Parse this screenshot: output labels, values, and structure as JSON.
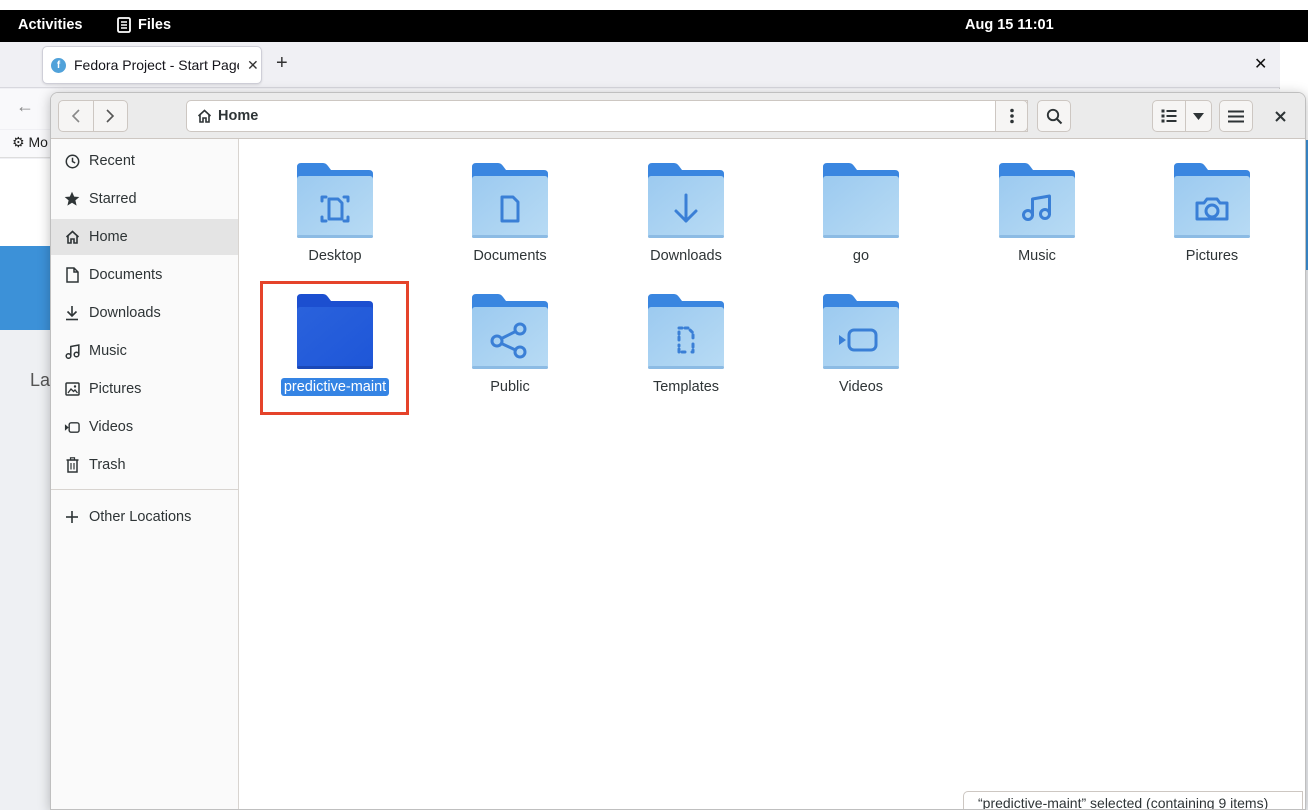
{
  "panel": {
    "activities": "Activities",
    "app_name": "Files",
    "clock": "Aug 15  11:01"
  },
  "browser": {
    "tab_title": "Fedora Project - Start Page",
    "bookmark_partial": "Mo",
    "content_partial": "La"
  },
  "files": {
    "path_label": "Home",
    "sidebar": [
      {
        "label": "Recent",
        "icon": "clock-icon"
      },
      {
        "label": "Starred",
        "icon": "star-icon"
      },
      {
        "label": "Home",
        "icon": "home-icon",
        "active": true
      },
      {
        "label": "Documents",
        "icon": "document-icon"
      },
      {
        "label": "Downloads",
        "icon": "download-icon"
      },
      {
        "label": "Music",
        "icon": "music-icon"
      },
      {
        "label": "Pictures",
        "icon": "picture-icon"
      },
      {
        "label": "Videos",
        "icon": "video-icon"
      },
      {
        "label": "Trash",
        "icon": "trash-icon"
      }
    ],
    "other_locations": "Other Locations",
    "folders": [
      {
        "label": "Desktop",
        "emblem": "desktop"
      },
      {
        "label": "Documents",
        "emblem": "document"
      },
      {
        "label": "Downloads",
        "emblem": "download"
      },
      {
        "label": "go",
        "emblem": "none"
      },
      {
        "label": "Music",
        "emblem": "music"
      },
      {
        "label": "Pictures",
        "emblem": "camera"
      },
      {
        "label": "predictive-maint",
        "emblem": "none",
        "selected": true
      },
      {
        "label": "Public",
        "emblem": "share"
      },
      {
        "label": "Templates",
        "emblem": "template"
      },
      {
        "label": "Videos",
        "emblem": "video"
      }
    ],
    "status": "“predictive-maint” selected  (containing 9 items)"
  },
  "colors": {
    "accent": "#3584e4",
    "folder_light": "#a8d0f0",
    "folder_selected": "#1c5fd6",
    "highlight_box": "#e5432a"
  }
}
